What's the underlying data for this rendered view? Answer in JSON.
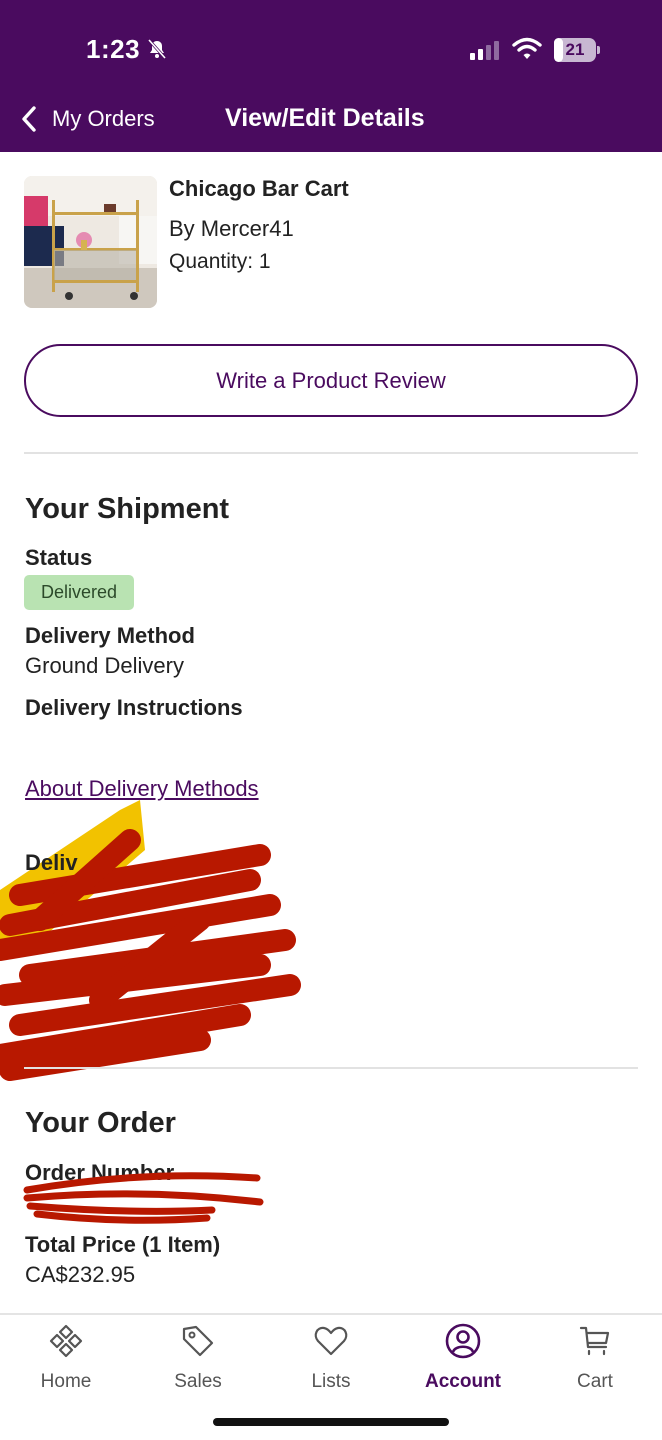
{
  "status_bar": {
    "time": "1:23",
    "battery": "21",
    "battery_level": 0.21
  },
  "header": {
    "back_label": "My Orders",
    "title": "View/Edit Details"
  },
  "product": {
    "name": "Chicago Bar Cart",
    "by": "By Mercer41",
    "quantity": "Quantity: 1",
    "image": "bar-cart-photo"
  },
  "review_button": "Write a Product Review",
  "shipment": {
    "title": "Your Shipment",
    "status_label": "Status",
    "status_badge": "Delivered",
    "method_label": "Delivery Method",
    "method_value": "Ground Delivery",
    "instructions_label": "Delivery Instructions",
    "about_link": "About Delivery Methods"
  },
  "order": {
    "title": "Your Order",
    "number_label": "Order Number",
    "total_label": "Total Price (1 Item)",
    "total_value": "CA$232.95"
  },
  "bottom_nav": [
    {
      "label": "Home",
      "icon": "home-icon"
    },
    {
      "label": "Sales",
      "icon": "tag-icon"
    },
    {
      "label": "Lists",
      "icon": "heart-icon"
    },
    {
      "label": "Account",
      "icon": "account-icon",
      "active": true
    },
    {
      "label": "Cart",
      "icon": "cart-icon"
    }
  ],
  "colors": {
    "brand": "#4a0b5f",
    "badge_bg": "#b9e3b2",
    "redaction": "#b81800",
    "highlighter": "#f2c200"
  }
}
